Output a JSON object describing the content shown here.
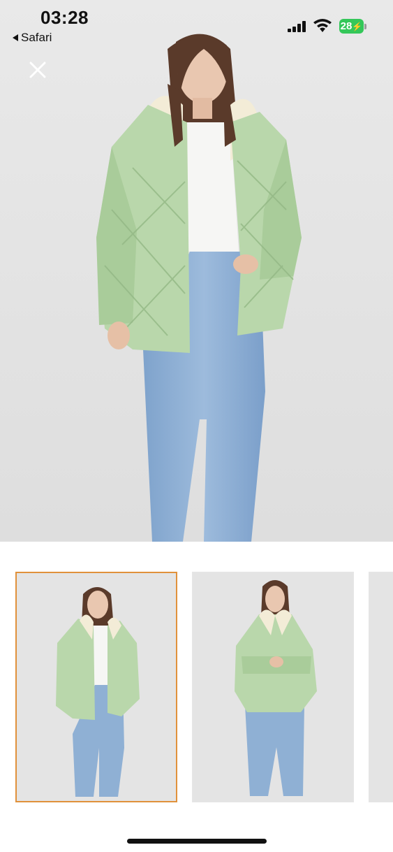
{
  "status_bar": {
    "time": "03:28",
    "back_app_label": "Safari",
    "battery_level": "28"
  },
  "gallery": {
    "main_image_alt": "Model wearing green quilted hooded puffer jacket with white top and light blue flared jeans",
    "thumbnails": [
      {
        "selected": true,
        "pose": "hand-in-pocket"
      },
      {
        "selected": false,
        "pose": "arms-crossed"
      },
      {
        "selected": false,
        "pose": "partial"
      }
    ]
  },
  "colors": {
    "jacket": "#b9d7ab",
    "jacket_shade": "#9fc58f",
    "lining": "#f3ecd7",
    "jeans": "#8fb0d4",
    "selected_border": "#e0913b",
    "battery": "#34c759"
  }
}
